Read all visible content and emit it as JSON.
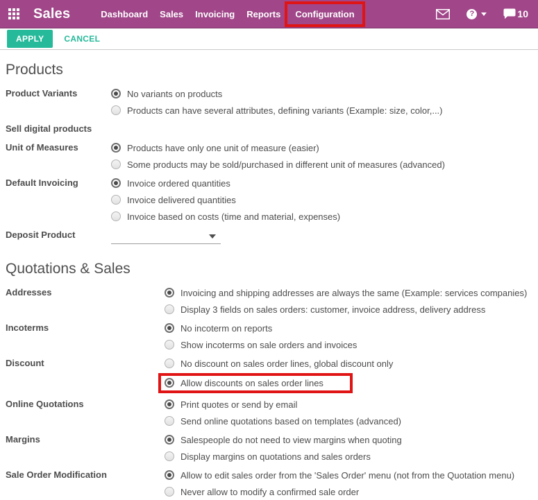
{
  "colors": {
    "topbar_bg": "#a04689",
    "accent_teal": "#26b99a",
    "annotation_red": "#e01414"
  },
  "topbar": {
    "app_title": "Sales",
    "menu_items": [
      "Dashboard",
      "Sales",
      "Invoicing",
      "Reports",
      "Configuration"
    ],
    "active_menu": "Configuration",
    "help_glyph": "?",
    "chat_count": "10"
  },
  "actionbar": {
    "apply_label": "APPLY",
    "cancel_label": "CANCEL"
  },
  "sections": [
    {
      "title": "Products",
      "groups": [
        {
          "label": "Product Variants",
          "options": [
            {
              "text": "No variants on products",
              "selected": true
            },
            {
              "text": "Products can have several attributes, defining variants (Example: size, color,...)",
              "selected": false
            }
          ]
        },
        {
          "label": "Sell digital products",
          "options": []
        },
        {
          "label": "Unit of Measures",
          "options": [
            {
              "text": "Products have only one unit of measure (easier)",
              "selected": true
            },
            {
              "text": "Some products may be sold/purchased in different unit of measures (advanced)",
              "selected": false
            }
          ]
        },
        {
          "label": "Default Invoicing",
          "options": [
            {
              "text": "Invoice ordered quantities",
              "selected": true
            },
            {
              "text": "Invoice delivered quantities",
              "selected": false
            },
            {
              "text": "Invoice based on costs (time and material, expenses)",
              "selected": false
            }
          ]
        },
        {
          "label": "Deposit Product",
          "widget": "dropdown",
          "value": ""
        }
      ]
    },
    {
      "title": "Quotations & Sales",
      "groups": [
        {
          "label": "Addresses",
          "options": [
            {
              "text": "Invoicing and shipping addresses are always the same (Example: services companies)",
              "selected": true
            },
            {
              "text": "Display 3 fields on sales orders: customer, invoice address, delivery address",
              "selected": false
            }
          ]
        },
        {
          "label": "Incoterms",
          "options": [
            {
              "text": "No incoterm on reports",
              "selected": true
            },
            {
              "text": "Show incoterms on sale orders and invoices",
              "selected": false
            }
          ]
        },
        {
          "label": "Discount",
          "options": [
            {
              "text": "No discount on sales order lines, global discount only",
              "selected": false
            },
            {
              "text": "Allow discounts on sales order lines",
              "selected": true,
              "highlighted": true
            }
          ]
        },
        {
          "label": "Online Quotations",
          "options": [
            {
              "text": "Print quotes or send by email",
              "selected": true
            },
            {
              "text": "Send online quotations based on templates (advanced)",
              "selected": false
            }
          ]
        },
        {
          "label": "Margins",
          "options": [
            {
              "text": "Salespeople do not need to view margins when quoting",
              "selected": true
            },
            {
              "text": "Display margins on quotations and sales orders",
              "selected": false
            }
          ]
        },
        {
          "label": "Sale Order Modification",
          "options": [
            {
              "text": "Allow to edit sales order from the 'Sales Order' menu (not from the Quotation menu)",
              "selected": true
            },
            {
              "text": "Never allow to modify a confirmed sale order",
              "selected": false
            }
          ]
        }
      ]
    }
  ]
}
